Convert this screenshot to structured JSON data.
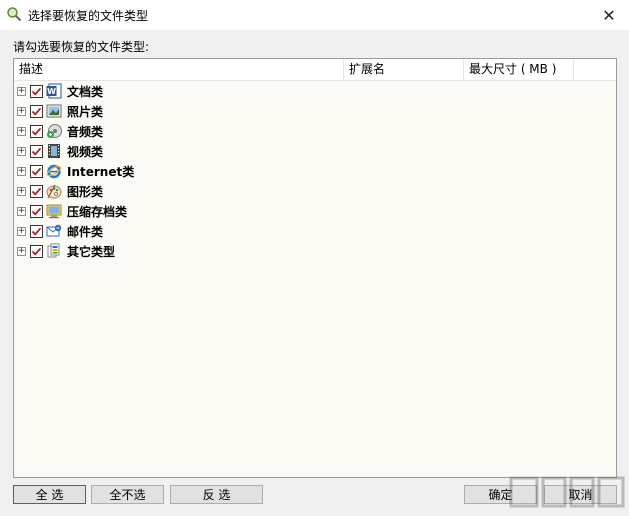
{
  "window": {
    "title": "选择要恢复的文件类型",
    "close_glyph": "✕"
  },
  "prompt": "请勾选要恢复的文件类型:",
  "columns": {
    "desc": "描述",
    "ext": "扩展名",
    "size": "最大尺寸 ( MB )"
  },
  "rows": [
    {
      "label": "文档类",
      "icon": "word-document-icon",
      "checked": true
    },
    {
      "label": "照片类",
      "icon": "photo-icon",
      "checked": true
    },
    {
      "label": "音频类",
      "icon": "audio-icon",
      "checked": true
    },
    {
      "label": "视频类",
      "icon": "video-film-icon",
      "checked": true
    },
    {
      "label": "Internet类",
      "icon": "internet-explorer-icon",
      "checked": true
    },
    {
      "label": "图形类",
      "icon": "graphics-palette-icon",
      "checked": true
    },
    {
      "label": "压缩存档类",
      "icon": "archive-icon",
      "checked": true
    },
    {
      "label": "邮件类",
      "icon": "mail-icon",
      "checked": true
    },
    {
      "label": "其它类型",
      "icon": "other-files-icon",
      "checked": true
    }
  ],
  "buttons": {
    "select_all": "全 选",
    "select_none": "全不选",
    "invert": "反 选",
    "ok": "确定",
    "cancel": "取消"
  },
  "colors": {
    "check": "#b01e23",
    "list_bg": "#fbfaf4",
    "focus": "#0078d7"
  }
}
